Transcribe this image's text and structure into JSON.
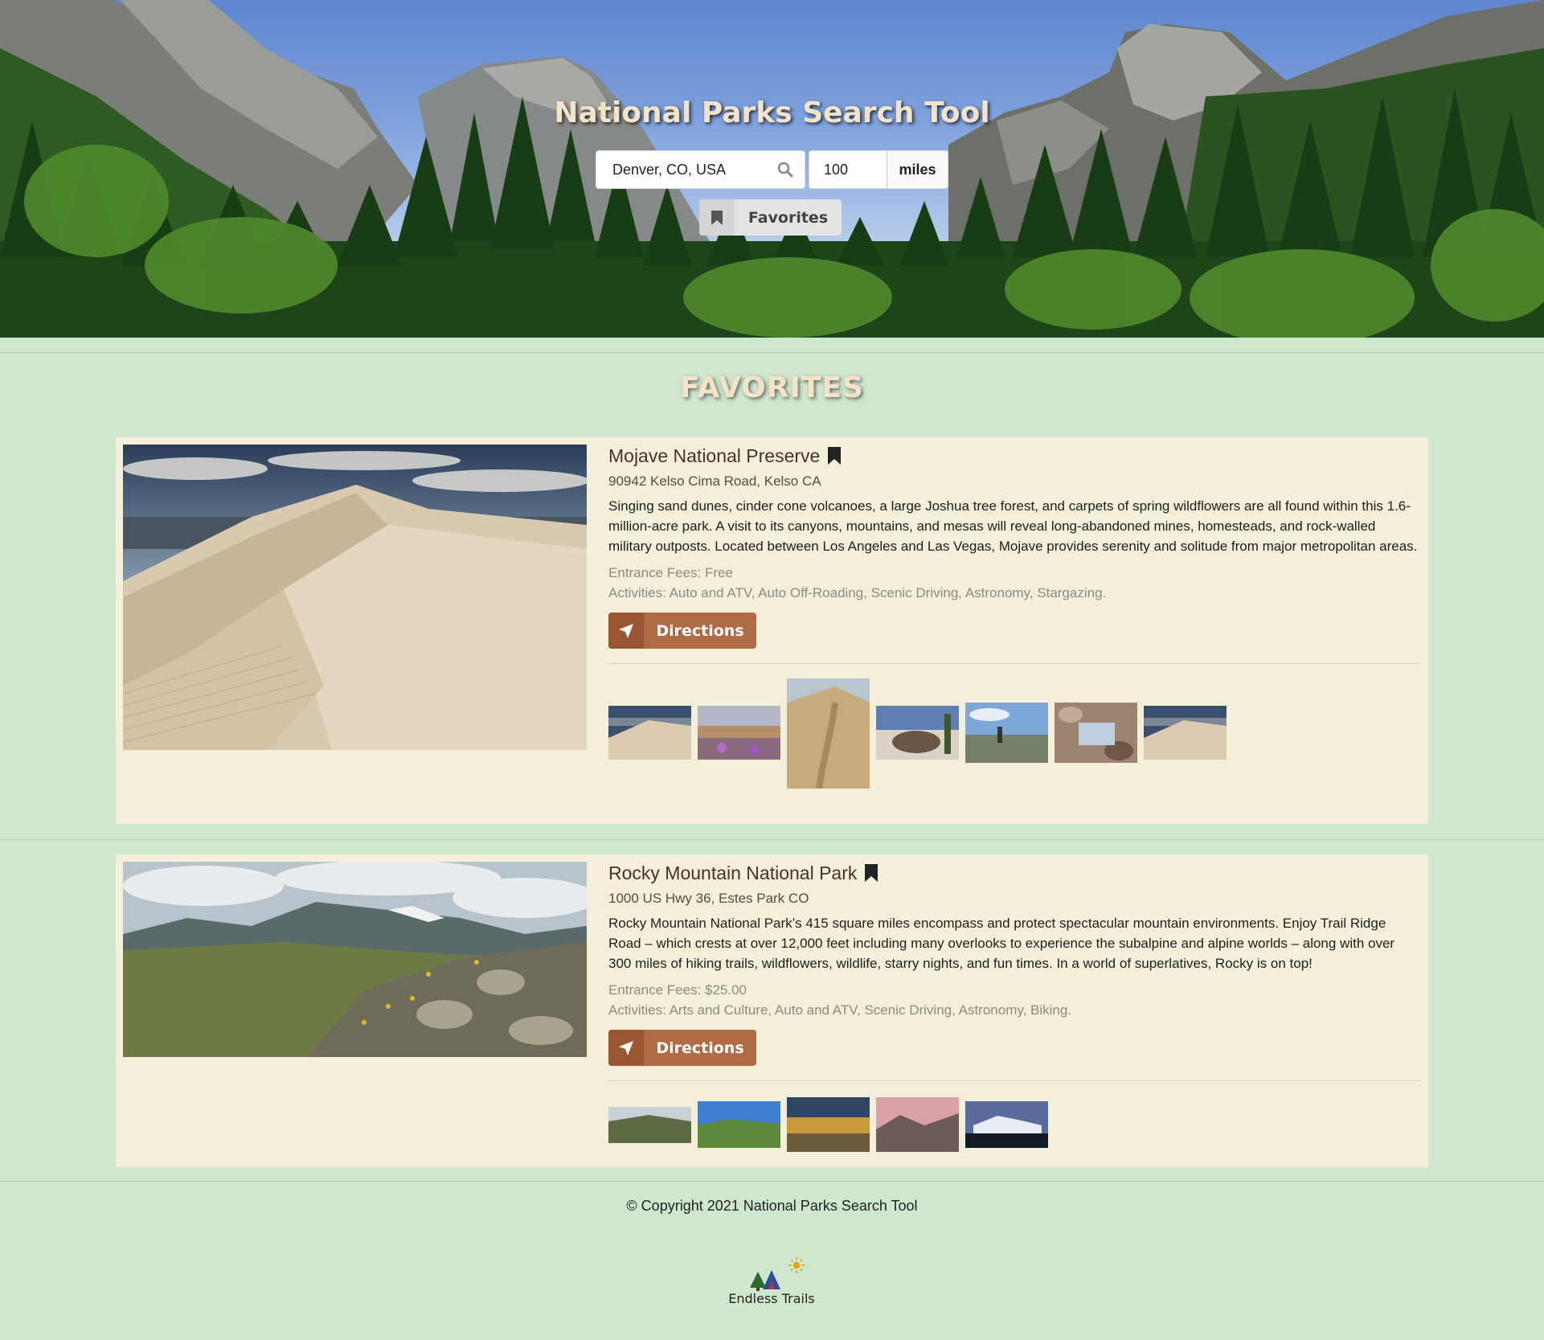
{
  "hero": {
    "title": "National Parks Search Tool",
    "location_value": "Denver, CO, USA",
    "distance_value": "100",
    "distance_unit": "miles",
    "favorites_label": "Favorites"
  },
  "section": {
    "title": "FAVORITES"
  },
  "parks": [
    {
      "name": "Mojave National Preserve",
      "address": "90942 Kelso Cima Road, Kelso CA",
      "description": "Singing sand dunes, cinder cone volcanoes, a large Joshua tree forest, and carpets of spring wildflowers are all found within this 1.6-million-acre park. A visit to its canyons, mountains, and mesas will reveal long-abandoned mines, homesteads, and rock-walled military outposts. Located between Los Angeles and Las Vegas, Mojave provides serenity and solitude from major metropolitan areas.",
      "fees": "Entrance Fees: Free",
      "activities": "Activities: Auto and ATV, Auto Off-Roading, Scenic Driving, Astronomy, Stargazing.",
      "directions_label": "Directions"
    },
    {
      "name": "Rocky Mountain National Park",
      "address": "1000 US Hwy 36, Estes Park CO",
      "description": "Rocky Mountain National Park’s 415 square miles encompass and protect spectacular mountain environments. Enjoy Trail Ridge Road – which crests at over 12,000 feet including many overlooks to experience the subalpine and alpine worlds – along with over 300 miles of hiking trails, wildflowers, wildlife, starry nights, and fun times. In a world of superlatives, Rocky is on top!",
      "fees": "Entrance Fees: $25.00",
      "activities": "Activities: Arts and Culture, Auto and ATV, Scenic Driving, Astronomy, Biking.",
      "directions_label": "Directions"
    }
  ],
  "footer": {
    "copyright": "© Copyright 2021 National Parks Search Tool",
    "logo_text": "Endless Trails"
  },
  "colors": {
    "page_bg": "#cfe6cf",
    "card_bg": "#f4efd9",
    "accent_brown": "#b06a44",
    "heading_cream": "#f3e3c8"
  },
  "icons": {
    "search": "magnifier-icon",
    "bookmark": "bookmark-icon",
    "directions": "location-arrow-icon"
  }
}
